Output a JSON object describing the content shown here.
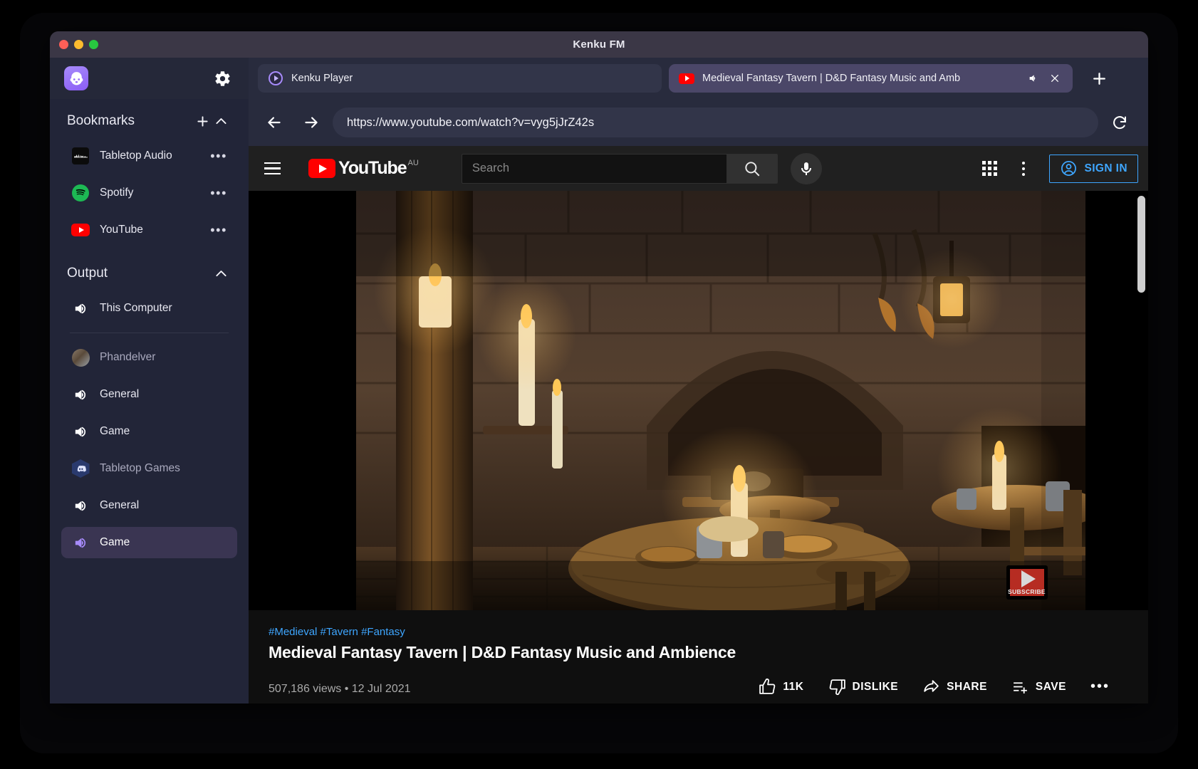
{
  "window": {
    "title": "Kenku FM",
    "traffic_lights": [
      "close",
      "minimize",
      "zoom"
    ]
  },
  "sidebar": {
    "logo_name": "kenku-logo",
    "settings_icon": "gear-icon",
    "bookmarks": {
      "title": "Bookmarks",
      "add_icon": "plus-icon",
      "collapse_icon": "chevron-up-icon",
      "items": [
        {
          "label": "Tabletop Audio",
          "icon": "tabletop-audio-icon",
          "menu": "•••"
        },
        {
          "label": "Spotify",
          "icon": "spotify-icon",
          "menu": "•••"
        },
        {
          "label": "YouTube",
          "icon": "youtube-icon",
          "menu": "•••"
        }
      ]
    },
    "output": {
      "title": "Output",
      "collapse_icon": "chevron-up-icon",
      "items": [
        {
          "label": "This Computer",
          "icon": "speaker-icon",
          "selected": false,
          "dim": false
        },
        {
          "label": "Phandelver",
          "icon": "avatar-icon",
          "selected": false,
          "dim": true
        },
        {
          "label": "General",
          "icon": "speaker-icon",
          "selected": false,
          "dim": false
        },
        {
          "label": "Game",
          "icon": "speaker-icon",
          "selected": false,
          "dim": false
        },
        {
          "label": "Tabletop Games",
          "icon": "discord-icon",
          "selected": false,
          "dim": true
        },
        {
          "label": "General",
          "icon": "speaker-icon",
          "selected": false,
          "dim": false
        },
        {
          "label": "Game",
          "icon": "speaker-icon",
          "selected": true,
          "dim": false
        }
      ]
    }
  },
  "browser": {
    "tabs": [
      {
        "title": "Kenku Player",
        "favicon": "kenku-player-icon",
        "active": false
      },
      {
        "title": "Medieval Fantasy Tavern | D&D Fantasy Music and Amb",
        "favicon": "youtube-icon",
        "active": true,
        "mute_icon": "speaker-icon",
        "close_icon": "close-icon"
      }
    ],
    "new_tab_icon": "plus-icon",
    "back_icon": "arrow-left-icon",
    "forward_icon": "arrow-right-icon",
    "reload_icon": "reload-icon",
    "url": "https://www.youtube.com/watch?v=vyg5jJrZ42s"
  },
  "youtube": {
    "menu_icon": "hamburger-icon",
    "logo_word": "YouTube",
    "country_code": "AU",
    "search_placeholder": "Search",
    "search_value": "",
    "search_icon": "search-icon",
    "mic_icon": "microphone-icon",
    "apps_icon": "grid-apps-icon",
    "more_icon": "kebab-menu-icon",
    "sign_in_label": "SIGN IN",
    "sign_in_icon": "account-circle-icon",
    "accent_blue": "#3ea6ff",
    "brand_red": "#ff0000",
    "video": {
      "watermark_label": "SUBSCRIBE",
      "hashtags": "#Medieval #Tavern #Fantasy",
      "title": "Medieval Fantasy Tavern | D&D Fantasy Music and Ambience",
      "views_line": "507,186 views • 12 Jul 2021",
      "actions": [
        {
          "label": "11K",
          "icon": "thumbs-up-icon"
        },
        {
          "label": "DISLIKE",
          "icon": "thumbs-down-icon"
        },
        {
          "label": "SHARE",
          "icon": "share-icon"
        },
        {
          "label": "SAVE",
          "icon": "save-playlist-icon"
        }
      ],
      "more_actions": "•••"
    }
  }
}
